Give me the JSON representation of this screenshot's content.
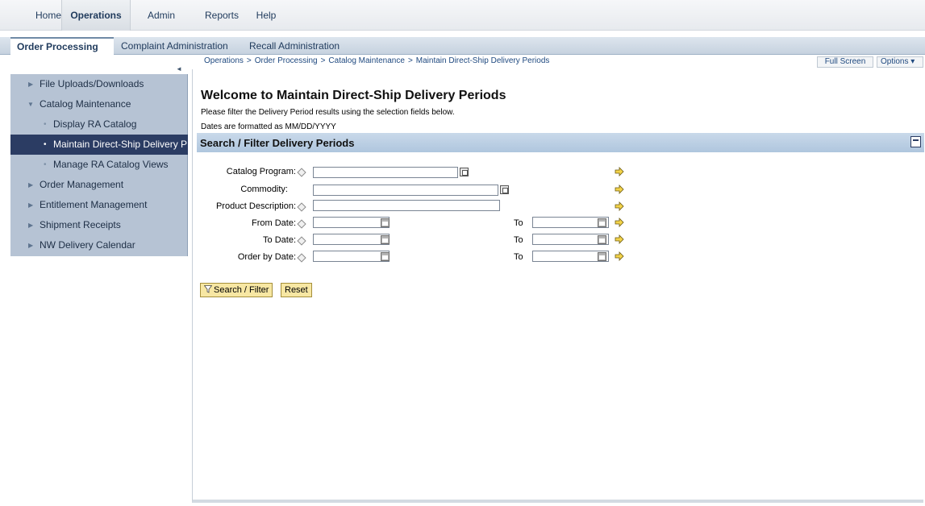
{
  "topnav": {
    "tabs": [
      {
        "label": "Home",
        "active": false
      },
      {
        "label": "Operations",
        "active": true
      },
      {
        "label": "Admin",
        "active": false
      },
      {
        "label": "Reports",
        "active": false
      },
      {
        "label": "Help",
        "active": false
      }
    ]
  },
  "subnav": {
    "tabs": [
      {
        "label": "Order Processing",
        "active": true
      },
      {
        "label": "Complaint Administration",
        "active": false
      },
      {
        "label": "Recall Administration",
        "active": false
      }
    ]
  },
  "breadcrumb": [
    "Operations",
    "Order Processing",
    "Catalog Maintenance",
    "Maintain Direct-Ship Delivery Periods"
  ],
  "breadcrumb_separator": ">",
  "actions": {
    "full_screen": "Full Screen",
    "options": "Options ▾"
  },
  "sidebar": {
    "items": [
      {
        "label": "File Uploads/Downloads",
        "type": "folder-collapsed"
      },
      {
        "label": "Catalog Maintenance",
        "type": "folder-expanded"
      },
      {
        "label": "Display RA Catalog",
        "type": "child"
      },
      {
        "label": "Maintain Direct-Ship Delivery P",
        "type": "child",
        "selected": true
      },
      {
        "label": "Manage RA Catalog Views",
        "type": "child"
      },
      {
        "label": "Order Management",
        "type": "folder-collapsed"
      },
      {
        "label": "Entitlement Management",
        "type": "folder-collapsed"
      },
      {
        "label": "Shipment Receipts",
        "type": "folder-collapsed"
      },
      {
        "label": "NW Delivery Calendar",
        "type": "folder-collapsed"
      }
    ]
  },
  "main": {
    "title": "Welcome to Maintain Direct-Ship Delivery Periods",
    "instructions": "Please filter the Delivery Period results using the selection fields below.",
    "date_format_note": "Dates are formatted as MM/DD/YYYY",
    "section_title": "Search / Filter Delivery Periods"
  },
  "form": {
    "catalog_program": {
      "label": "Catalog Program:",
      "value": ""
    },
    "commodity": {
      "label": "Commodity:",
      "value": ""
    },
    "product_description": {
      "label": "Product Description:",
      "value": ""
    },
    "from_date": {
      "label": "From Date:",
      "from": "",
      "to_label": "To",
      "to": ""
    },
    "to_date": {
      "label": "To Date:",
      "from": "",
      "to_label": "To",
      "to": ""
    },
    "order_by_date": {
      "label": "Order by Date:",
      "from": "",
      "to_label": "To",
      "to": ""
    }
  },
  "buttons": {
    "search_filter": "Search / Filter",
    "reset": "Reset"
  },
  "colors": {
    "accent": "#2b3c63",
    "sidebar": "#b6c3d4",
    "section_bar": "#c9d9ea",
    "button": "#f7e7a3"
  }
}
